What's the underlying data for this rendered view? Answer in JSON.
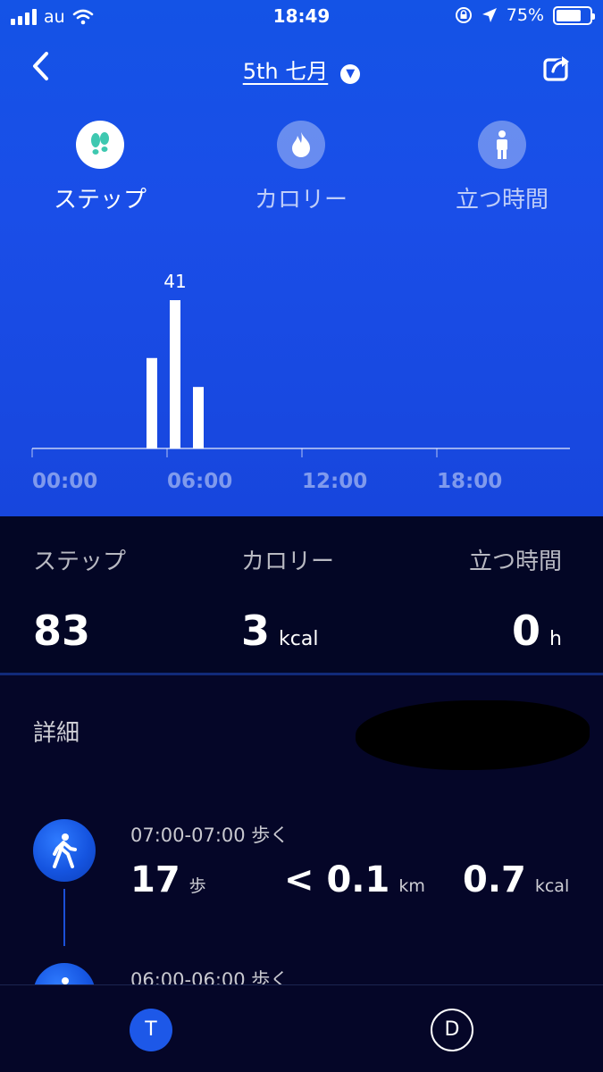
{
  "status": {
    "carrier": "au",
    "time": "18:49",
    "battery": "75%",
    "battery_level": 0.75
  },
  "header": {
    "date": "5th 七月"
  },
  "tabs": [
    {
      "label": "ステップ",
      "icon": "footprints-icon",
      "active": true
    },
    {
      "label": "カロリー",
      "icon": "flame-icon",
      "active": false
    },
    {
      "label": "立つ時間",
      "icon": "standing-person-icon",
      "active": false
    }
  ],
  "chart_data": {
    "type": "bar",
    "x": [
      4,
      5,
      6
    ],
    "values": [
      25,
      41,
      17
    ],
    "value_labels": {
      "5": "41"
    },
    "xlim": [
      0,
      24
    ],
    "ylim": [
      0,
      41
    ],
    "xticks": [
      "00:00",
      "06:00",
      "12:00",
      "18:00"
    ],
    "xtick_values": [
      0,
      6,
      12,
      18
    ]
  },
  "summary": [
    {
      "label": "ステップ",
      "value": "83",
      "unit": ""
    },
    {
      "label": "カロリー",
      "value": "3",
      "unit": "kcal"
    },
    {
      "label": "立つ時間",
      "value": "0",
      "unit": "h"
    }
  ],
  "details": {
    "title": "詳細",
    "items": [
      {
        "time": "07:00-07:00 歩く",
        "steps": "17",
        "steps_unit": "歩",
        "distance": "< 0.1",
        "distance_unit": "km",
        "calories": "0.7",
        "calories_unit": "kcal"
      },
      {
        "time": "06:00-06:00 歩く"
      }
    ]
  },
  "nav": {
    "t_label": "T",
    "d_label": "D"
  }
}
